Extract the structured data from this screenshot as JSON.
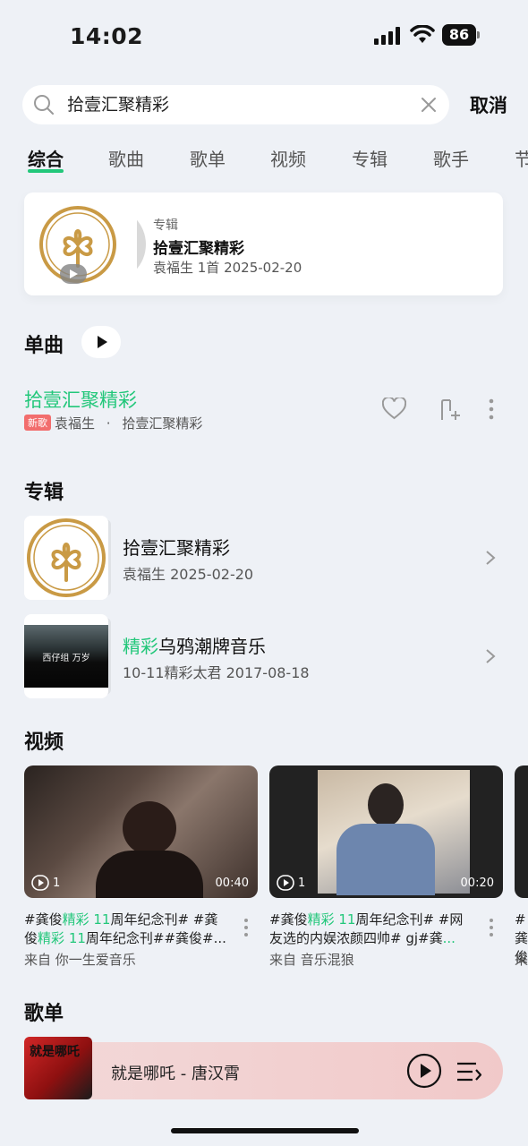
{
  "status": {
    "time": "14:02",
    "battery": "86"
  },
  "search": {
    "query": "拾壹汇聚精彩",
    "cancel": "取消"
  },
  "tabs": [
    "综合",
    "歌曲",
    "歌单",
    "视频",
    "专辑",
    "歌手",
    "节"
  ],
  "top_card": {
    "type": "专辑",
    "title": "拾壹汇聚精彩",
    "meta": "袁福生   1首   2025-02-20"
  },
  "singles": {
    "title": "单曲",
    "song": {
      "title": "拾壹汇聚精彩",
      "badge": "新歌",
      "artist": "袁福生",
      "separator": "·",
      "album": "拾壹汇聚精彩"
    }
  },
  "albums": {
    "title": "专辑",
    "items": [
      {
        "title": "拾壹汇聚精彩",
        "meta": "袁福生  2025-02-20"
      },
      {
        "title_hl": "精彩",
        "title_rest": "乌鸦潮牌音乐",
        "meta": "10-11精彩太君  2017-08-18",
        "thumb_text": "西仔组 万岁"
      }
    ]
  },
  "videos": {
    "title": "视频",
    "items": [
      {
        "count": "1",
        "duration": "00:40",
        "desc": [
          "#龚俊",
          "精彩",
          " ",
          "11",
          "周年纪念刊# #龚",
          "俊",
          "精彩",
          " ",
          "11",
          "周年纪念刊##龚俊#..."
        ],
        "source": "来自  你一生爱音乐"
      },
      {
        "count": "1",
        "duration": "00:20",
        "desc": [
          "#龚俊",
          "精彩",
          " ",
          "11",
          "周年纪念刊# #网",
          "友选的内娱浓颜四帅# gj#龚",
          "..."
        ],
        "source": "来自  音乐混狼"
      },
      {
        "partial_desc": "#龚",
        "partial_desc2": "俊",
        "partial_src": "来"
      }
    ]
  },
  "playlists": {
    "title": "歌单"
  },
  "player": {
    "title": "就是哪吒 - 唐汉霄",
    "cover_text": "就是哪吒"
  },
  "colors": {
    "accent": "#22c77a",
    "background": "#eef1f6",
    "badge": "#f26d6d"
  }
}
